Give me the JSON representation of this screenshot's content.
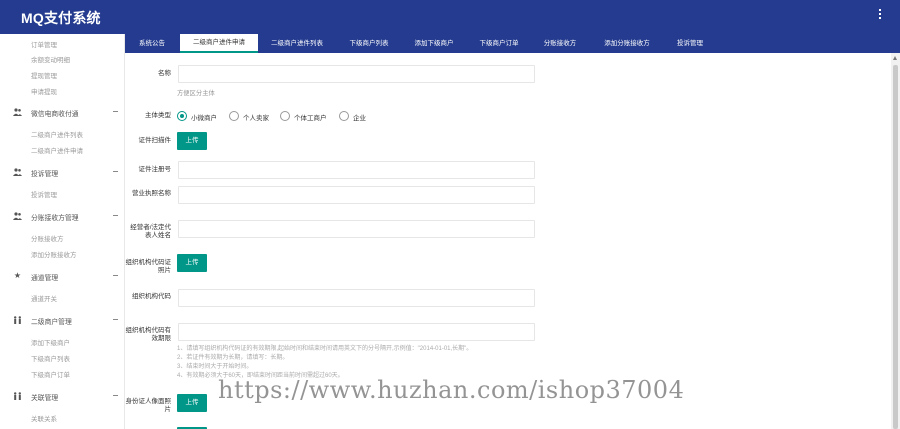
{
  "app": {
    "title": "MQ支付系统"
  },
  "sidebar": {
    "top_links": [
      "订单管理",
      "余额变动明细",
      "提现管理",
      "申请提现"
    ],
    "groups": [
      {
        "label": "微信电商收付通",
        "icon": "users-icon",
        "items": [
          "二级商户进件列表",
          "二级商户进件申请"
        ]
      },
      {
        "label": "投诉管理",
        "icon": "users-icon",
        "items": [
          "投诉管理"
        ]
      },
      {
        "label": "分账接收方管理",
        "icon": "users-icon",
        "items": [
          "分账接收方",
          "添加分账接收方"
        ]
      },
      {
        "label": "通道管理",
        "icon": "star-icon",
        "items": [
          "通道开关"
        ]
      },
      {
        "label": "二级商户管理",
        "icon": "user-pair-icon",
        "items": [
          "添加下级商户",
          "下级商户列表",
          "下级商户订单"
        ]
      },
      {
        "label": "关联管理",
        "icon": "user-pair-icon",
        "items": [
          "关联关系"
        ]
      }
    ]
  },
  "tabs": [
    "系统公告",
    "二级商户进件申请",
    "二级商户进件列表",
    "下级商户列表",
    "添加下级商户",
    "下级商户订单",
    "分账接收方",
    "添加分账接收方",
    "投诉管理"
  ],
  "active_tab": "二级商户进件申请",
  "form": {
    "name_label": "名称",
    "name_hint": "方便区分主体",
    "subject_type_label": "主体类型",
    "subject_types": [
      "小微商户",
      "个人卖家",
      "个体工商户",
      "企业"
    ],
    "selected_subject_type": "小微商户",
    "upload_label": "上传",
    "cert_scan_label": "证件扫描件",
    "cert_number_label": "证件注册号",
    "license_name_label": "营业执照名称",
    "legal_rep_label": "经营者/法定代表人姓名",
    "org_code_photo_label": "组织机构代码证照片",
    "org_code_label": "组织机构代码",
    "org_code_validity_label": "组织机构代码有效期限",
    "notes": [
      "1、请填写组织机构代码证的有效期限,起始时间和结束时间请用英文下的分号隔开,示例值：\"2014-01-01,长期\"。",
      "2、若证件有效期为长期，请填写：长期。",
      "3、结束时间大于开始时间。",
      "4、有效期必须大于60天，即结束时间距当前时间需超过60天。"
    ],
    "id_card_photo_label": "身份证人像面照片"
  },
  "watermark": "https://www.huzhan.com/ishop37004",
  "colors": {
    "header": "#243b8f",
    "accent": "#009688"
  }
}
